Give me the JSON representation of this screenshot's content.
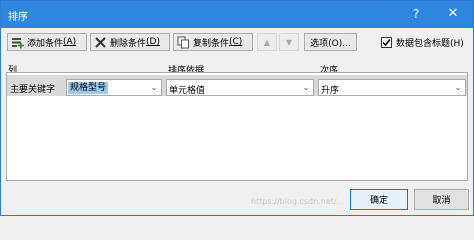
{
  "window": {
    "title": "排序",
    "help_label": "?",
    "close_label": "✕"
  },
  "toolbar": {
    "add_label": "添加条件",
    "add_key": "(A)",
    "delete_label": "删除条件",
    "delete_key": "(D)",
    "copy_label": "复制条件",
    "copy_key": "(C)",
    "move_up_icon": "▲",
    "move_down_icon": "▼",
    "options_label": "选项(O)...",
    "header_checkbox_label": "数据包含标题(H)",
    "header_checkbox_checked": true
  },
  "columns": {
    "col": "列",
    "sort_on": "排序依据",
    "order": "次序"
  },
  "rows": [
    {
      "label": "主要关键字",
      "key_value": "规格型号",
      "sort_on_value": "单元格值",
      "order_value": "升序"
    }
  ],
  "buttons": {
    "ok": "确定",
    "cancel": "取消"
  },
  "watermark": "https://blog.csdn.net/..."
}
